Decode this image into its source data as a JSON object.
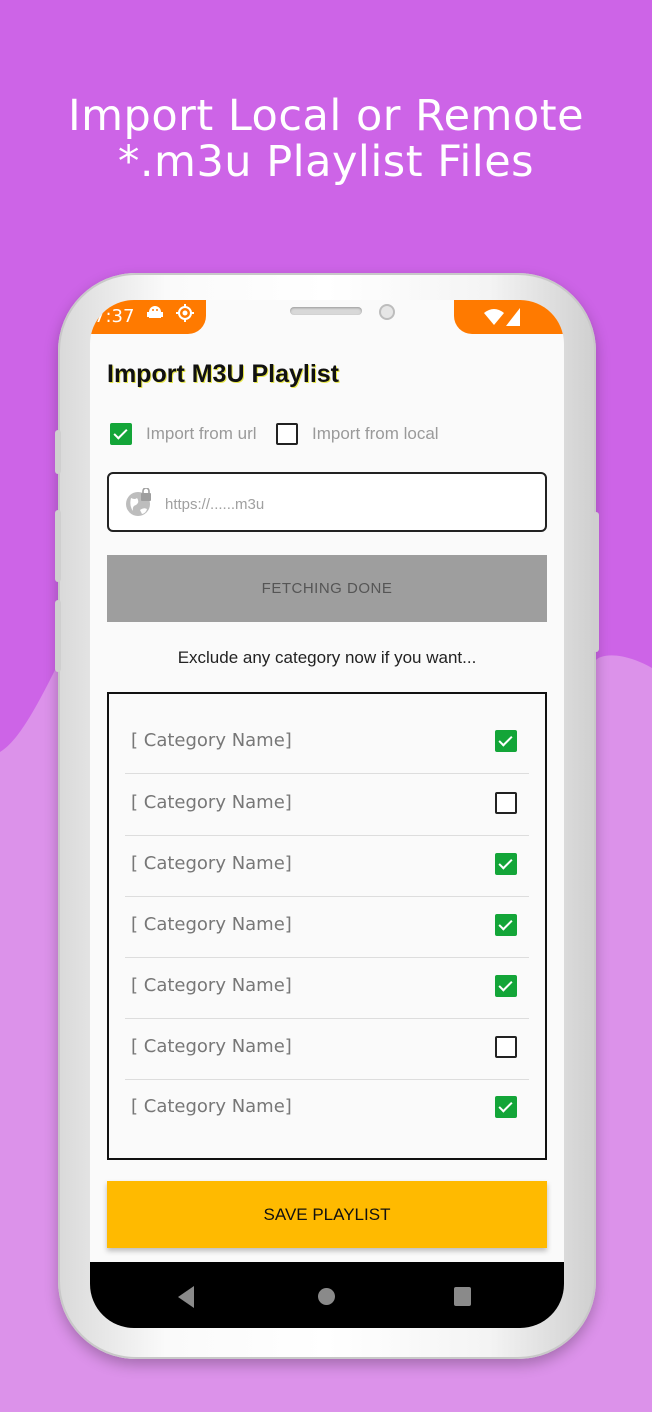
{
  "colors": {
    "background_top": "#cd64e7",
    "background_bottom": "#dc92ea",
    "status_bar": "#ff7a00",
    "checkbox_checked": "#13a538",
    "save_button": "#ffba00",
    "fetch_button": "#9e9e9e"
  },
  "headline": {
    "line1": "Import Local or Remote",
    "line2": "*.m3u Playlist Files"
  },
  "status_bar": {
    "time": "7:37",
    "left_icons": [
      "android-debug-icon",
      "settings-sync-icon"
    ],
    "right_icons": [
      "wifi-icon",
      "signal-icon"
    ]
  },
  "screen": {
    "title": "Import M3U Playlist",
    "import_options": [
      {
        "label": "Import from url",
        "checked": true
      },
      {
        "label": "Import from local",
        "checked": false
      }
    ],
    "url_field": {
      "icon": "globe-lock-icon",
      "placeholder": "https://......m3u",
      "value": ""
    },
    "fetch_button": "FETCHING DONE",
    "exclude_hint": "Exclude any category now if you want...",
    "categories": [
      {
        "name": "[ Category Name]",
        "checked": true
      },
      {
        "name": "[ Category Name]",
        "checked": false
      },
      {
        "name": "[ Category Name]",
        "checked": true
      },
      {
        "name": "[ Category Name]",
        "checked": true
      },
      {
        "name": "[ Category Name]",
        "checked": true
      },
      {
        "name": "[ Category Name]",
        "checked": false
      },
      {
        "name": "[ Category Name]",
        "checked": true
      }
    ],
    "save_button": "SAVE PLAYLIST"
  },
  "nav_bar": {
    "icons": [
      "back-icon",
      "home-icon",
      "recents-icon"
    ]
  }
}
